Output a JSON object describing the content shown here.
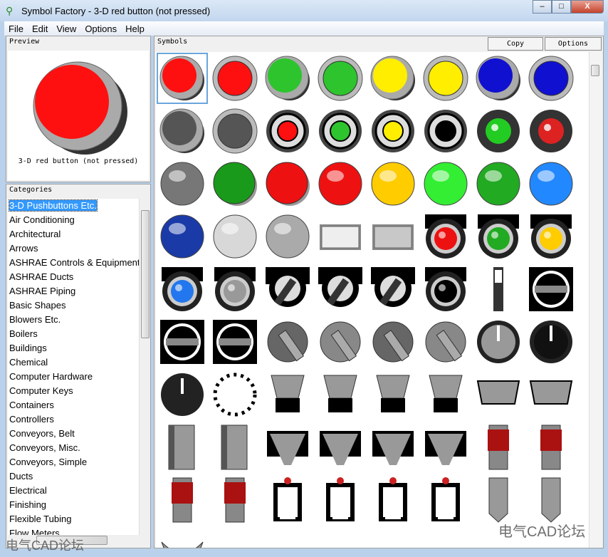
{
  "window": {
    "title": "Symbol Factory - 3-D red button (not pressed)",
    "minimize": "–",
    "maximize": "□",
    "close": "X"
  },
  "menu": [
    "File",
    "Edit",
    "View",
    "Options",
    "Help"
  ],
  "preview": {
    "label": "Preview",
    "caption": "3-D red button (not pressed)",
    "color": "#ff1010"
  },
  "categories": {
    "label": "Categories",
    "selected": 0,
    "items": [
      "3-D Pushbuttons Etc.",
      "Air Conditioning",
      "Architectural",
      "Arrows",
      "ASHRAE Controls & Equipment",
      "ASHRAE Ducts",
      "ASHRAE Piping",
      "Basic Shapes",
      "Blowers Etc.",
      "Boilers",
      "Buildings",
      "Chemical",
      "Computer Hardware",
      "Computer Keys",
      "Containers",
      "Controllers",
      "Conveyors, Belt",
      "Conveyors, Misc.",
      "Conveyors, Simple",
      "Ducts",
      "Electrical",
      "Finishing",
      "Flexible Tubing",
      "Flow Meters"
    ]
  },
  "symbols_panel": {
    "label": "Symbols",
    "copy": "Copy",
    "options": "Options",
    "selected": 0,
    "rows": [
      [
        [
          "b3d",
          "#ff1010"
        ],
        [
          "b3dp",
          "#ff1010"
        ],
        [
          "b3d",
          "#2ec42e"
        ],
        [
          "b3dp",
          "#2ec42e"
        ],
        [
          "b3d",
          "#ffee00"
        ],
        [
          "b3dp",
          "#ffee00"
        ],
        [
          "b3d",
          "#1010d0"
        ],
        [
          "b3dp",
          "#1010d0"
        ]
      ],
      [
        [
          "b3d",
          "#555555"
        ],
        [
          "b3dp",
          "#555555"
        ],
        [
          "ring",
          "#ff1010"
        ],
        [
          "ring",
          "#2ec42e"
        ],
        [
          "ring",
          "#ffee00"
        ],
        [
          "ring",
          "#000000"
        ],
        [
          "glow",
          "#22cc22"
        ],
        [
          "glow",
          "#dd2222"
        ]
      ],
      [
        [
          "sphere",
          "#777777"
        ],
        [
          "flat",
          "#1a9a1a"
        ],
        [
          "flat",
          "#ee1111"
        ],
        [
          "sphere",
          "#ee1111"
        ],
        [
          "sphere",
          "#ffcc00"
        ],
        [
          "sphere",
          "#33ee33"
        ],
        [
          "sphere",
          "#22aa22"
        ],
        [
          "sphere",
          "#2288ff"
        ]
      ],
      [
        [
          "sphere",
          "#1a3aa8"
        ],
        [
          "sphere",
          "#d8d8d8"
        ],
        [
          "sphere",
          "#aaaaaa"
        ],
        [
          "rect",
          "#eeeeee"
        ],
        [
          "rect",
          "#c8c8c8"
        ],
        [
          "housed",
          "#ee1111"
        ],
        [
          "housed",
          "#22aa22"
        ],
        [
          "housed",
          "#ffcc00"
        ]
      ],
      [
        [
          "housed",
          "#2277ee"
        ],
        [
          "housed",
          "#999999"
        ],
        [
          "key",
          "#333333"
        ],
        [
          "key",
          "#333333"
        ],
        [
          "key",
          "#333333"
        ],
        [
          "housed",
          "#000000"
        ],
        [
          "slider",
          "#333333"
        ],
        [
          "selector",
          "#000000"
        ]
      ],
      [
        [
          "selector",
          "#000000"
        ],
        [
          "selector",
          "#000000"
        ],
        [
          "lever",
          "#666666"
        ],
        [
          "lever",
          "#888888"
        ],
        [
          "lever",
          "#666666"
        ],
        [
          "lever",
          "#888888"
        ],
        [
          "knob",
          "#999999"
        ],
        [
          "knob",
          "#111111"
        ]
      ],
      [
        [
          "knob",
          "#222222"
        ],
        [
          "dial",
          "#000000"
        ],
        [
          "hopper",
          "#999999"
        ],
        [
          "hopper",
          "#999999"
        ],
        [
          "hopper",
          "#999999"
        ],
        [
          "hopper",
          "#999999"
        ],
        [
          "tray",
          "#999999"
        ],
        [
          "tray",
          "#999999"
        ]
      ],
      [
        [
          "beam",
          "#999999"
        ],
        [
          "beam",
          "#999999"
        ],
        [
          "chute",
          "#999999"
        ],
        [
          "chute",
          "#999999"
        ],
        [
          "chute",
          "#999999"
        ],
        [
          "chute",
          "#999999"
        ],
        [
          "stack",
          "#aa1111"
        ],
        [
          "stack",
          "#aa1111"
        ]
      ],
      [
        [
          "stack",
          "#aa1111"
        ],
        [
          "stack",
          "#aa1111"
        ],
        [
          "fork",
          "#555555"
        ],
        [
          "fork",
          "#555555"
        ],
        [
          "fork",
          "#555555"
        ],
        [
          "fork",
          "#555555"
        ],
        [
          "blade",
          "#999999"
        ],
        [
          "blade",
          "#999999"
        ]
      ],
      [
        [
          "curve",
          "#999999"
        ]
      ]
    ]
  },
  "watermark": {
    "left": "电气CAD论坛",
    "right": "电气CAD论坛"
  }
}
